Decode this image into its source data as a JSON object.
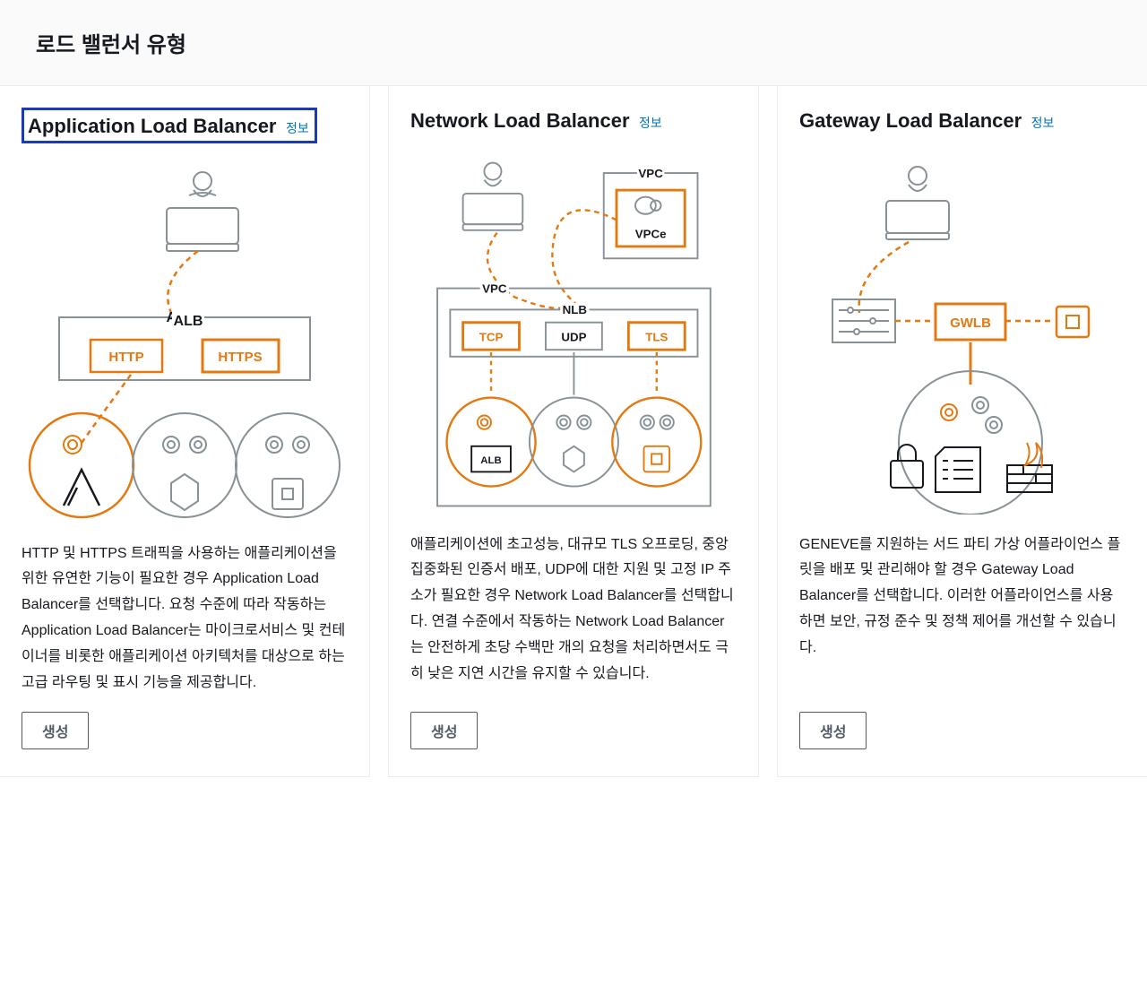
{
  "header": {
    "title": "로드 밸런서 유형"
  },
  "info_label": "정보",
  "create_label": "생성",
  "cards": {
    "alb": {
      "title": "Application Load Balancer",
      "description": "HTTP 및 HTTPS 트래픽을 사용하는 애플리케이션을 위한 유연한 기능이 필요한 경우 Application Load Balancer를 선택합니다. 요청 수준에 따라 작동하는 Application Load Balancer는 마이크로서비스 및 컨테이너를 비롯한 애플리케이션 아키텍처를 대상으로 하는 고급 라우팅 및 표시 기능을 제공합니다.",
      "labels": {
        "alb": "ALB",
        "http": "HTTP",
        "https": "HTTPS"
      }
    },
    "nlb": {
      "title": "Network Load Balancer",
      "description": "애플리케이션에 초고성능, 대규모 TLS 오프로딩, 중앙 집중화된 인증서 배포, UDP에 대한 지원 및 고정 IP 주소가 필요한 경우 Network Load Balancer를 선택합니다. 연결 수준에서 작동하는 Network Load Balancer는 안전하게 초당 수백만 개의 요청을 처리하면서도 극히 낮은 지연 시간을 유지할 수 있습니다.",
      "labels": {
        "vpc": "VPC",
        "vpce": "VPCe",
        "nlb": "NLB",
        "tcp": "TCP",
        "udp": "UDP",
        "tls": "TLS",
        "alb": "ALB"
      }
    },
    "gwlb": {
      "title": "Gateway Load Balancer",
      "description": "GENEVE를 지원하는 서드 파티 가상 어플라이언스 플릿을 배포 및 관리해야 할 경우 Gateway Load Balancer를 선택합니다. 이러한 어플라이언스를 사용하면 보안, 규정 준수 및 정책 제어를 개선할 수 있습니다.",
      "labels": {
        "gwlb": "GWLB"
      }
    }
  }
}
